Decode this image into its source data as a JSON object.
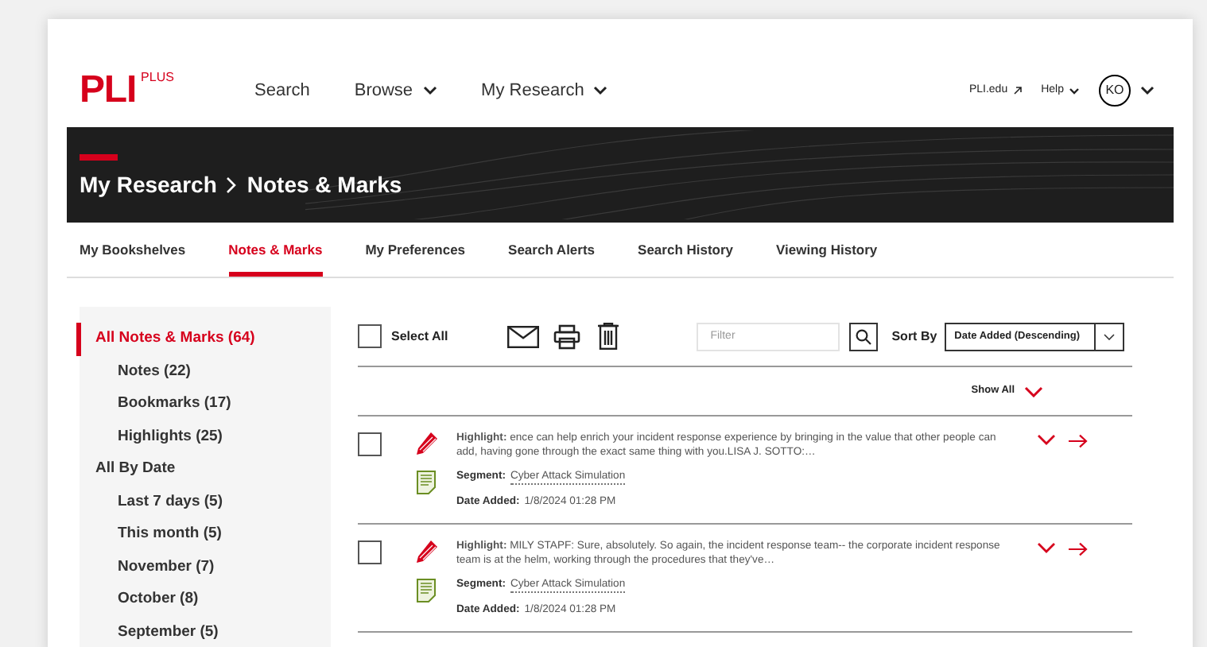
{
  "header": {
    "logo": "PLI",
    "logo_super": "PLUS",
    "nav": [
      {
        "label": "Search",
        "dropdown": false
      },
      {
        "label": "Browse",
        "dropdown": true
      },
      {
        "label": "My Research",
        "dropdown": true
      }
    ],
    "links": [
      {
        "label": "PLI.edu",
        "kind": "external"
      },
      {
        "label": "Help",
        "kind": "dropdown"
      }
    ],
    "avatar": "KO"
  },
  "banner": {
    "breadcrumb": [
      "My Research",
      "Notes & Marks"
    ]
  },
  "tabs": [
    {
      "label": "My Bookshelves",
      "selected": false
    },
    {
      "label": "Notes & Marks",
      "selected": true
    },
    {
      "label": "My Preferences",
      "selected": false
    },
    {
      "label": "Search Alerts",
      "selected": false
    },
    {
      "label": "Search History",
      "selected": false
    },
    {
      "label": "Viewing History",
      "selected": false
    }
  ],
  "sidebar": {
    "items": [
      {
        "label": "All Notes & Marks (64)",
        "selected": true,
        "children": [
          {
            "label": "Notes (22)",
            "selected": false
          },
          {
            "label": "Bookmarks (17)",
            "selected": false
          },
          {
            "label": "Highlights (25)",
            "selected": false
          }
        ]
      },
      {
        "label": "All By Date",
        "selected": false,
        "children": [
          {
            "label": "Last 7 days (5)",
            "selected": false
          },
          {
            "label": "This month (5)",
            "selected": false
          },
          {
            "label": "November (7)",
            "selected": false
          },
          {
            "label": "October (8)",
            "selected": false
          },
          {
            "label": "September (5)",
            "selected": false
          }
        ]
      }
    ]
  },
  "toolbar": {
    "select_all": {
      "label": "Select All",
      "checked": false
    },
    "filter": {
      "placeholder": "Filter"
    },
    "sort_label": "Sort By",
    "sort_value": "Date Added (Descending)"
  },
  "show_all": "Show All",
  "rows": [
    {
      "checked": false,
      "text": "**Highlight:** ence can help enrich your incident response experience by bringing in the value that other people can add, having gone through the exact same thing with you.LISA J. SOTTO:…",
      "segment_label": "Segment:",
      "segment": "Cyber Attack Simulation",
      "date_label": "Date Added:",
      "date": "1/8/2024 01:28 PM"
    },
    {
      "checked": false,
      "text": "**Highlight:** MILY STAPF: Sure, absolutely. So again, the incident response team-- the corporate incident response team is at the helm, working through the procedures that they've…",
      "segment_label": "Segment:",
      "segment": "Cyber Attack Simulation",
      "date_label": "Date Added:",
      "date": "1/8/2024 01:28 PM"
    }
  ]
}
